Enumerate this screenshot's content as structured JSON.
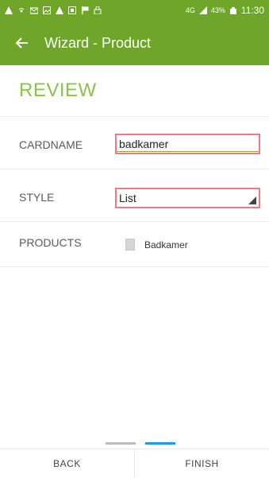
{
  "status_bar": {
    "network": "4G",
    "battery": "43%",
    "time": "11:30",
    "icons": [
      "warning-icon",
      "hotspot-icon",
      "mail-icon",
      "image-icon",
      "warning-icon",
      "screenshot-icon",
      "flag-icon",
      "lock-icon"
    ]
  },
  "app_bar": {
    "title": "Wizard - Product",
    "color": "#6fa62a"
  },
  "review": {
    "title": "REVIEW",
    "cardname_label": "CARDNAME",
    "cardname_value": "badkamer",
    "style_label": "STYLE",
    "style_value": "List",
    "products_label": "PRODUCTS",
    "product_item": "Badkamer"
  },
  "pager": {
    "active_index": 1,
    "total": 2
  },
  "bottom": {
    "back": "BACK",
    "finish": "FINISH"
  },
  "colors": {
    "accent": "#8bc34a",
    "error_border": "#f07887",
    "pager_active": "#2196f3",
    "pager_inactive": "#bdbdbd"
  }
}
